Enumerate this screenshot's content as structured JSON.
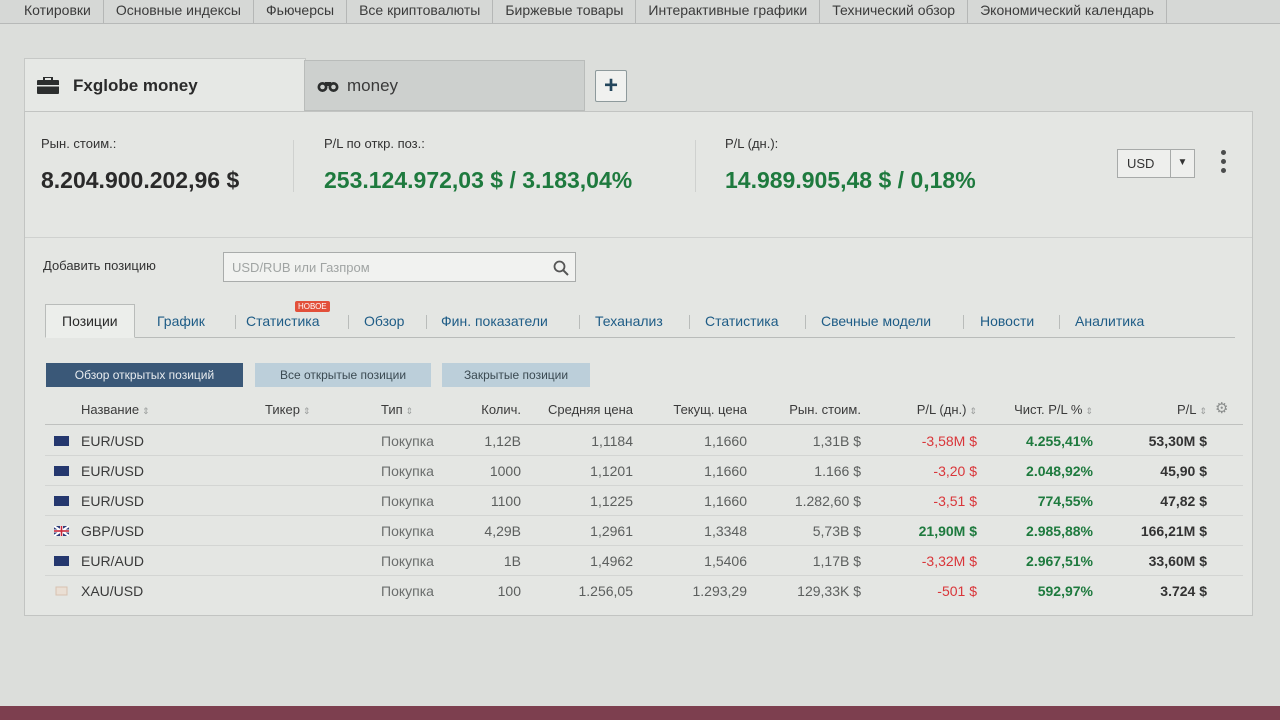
{
  "topnav": [
    "Котировки",
    "Основные индексы",
    "Фьючерсы",
    "Все криптовалюты",
    "Биржевые товары",
    "Интерактивные графики",
    "Технический обзор",
    "Экономический календарь"
  ],
  "portfolio_tabs": {
    "active": "Fxglobe money",
    "inactive": "money",
    "add_label": "+"
  },
  "summary": {
    "market_value": {
      "caption": "Рын. стоим.:",
      "value": "8.204.900.202,96 $"
    },
    "open_pl": {
      "caption": "P/L по откр. поз.:",
      "value": "253.124.972,03 $ / 3.183,04%"
    },
    "daily_pl": {
      "caption": "P/L (дн.):",
      "value": "14.989.905,48 $ / 0,18%"
    },
    "currency": "USD"
  },
  "add_position": {
    "label": "Добавить позицию",
    "placeholder": "USD/RUB или Газпром"
  },
  "subtabs": [
    "Позиции",
    "График",
    "Статистика",
    "Обзор",
    "Фин. показатели",
    "Теханализ",
    "Статистика",
    "Свечные модели",
    "Новости",
    "Аналитика"
  ],
  "new_badge": "НОВОЕ",
  "filters": [
    "Обзор открытых позиций",
    "Все открытые позиции",
    "Закрытые позиции"
  ],
  "columns": [
    "Название",
    "Тикер",
    "Тип",
    "Колич.",
    "Средняя цена",
    "Текущ. цена",
    "Рын. стоим.",
    "P/L (дн.)",
    "Чист. P/L %",
    "P/L"
  ],
  "rows": [
    {
      "name": "EUR/USD",
      "ticker": "",
      "type": "Покупка",
      "qty": "1,12B",
      "avg": "1,1184",
      "cur": "1,1660",
      "mv": "1,31B $",
      "pl_day": "-3,58M $",
      "net_pct": "4.255,41%",
      "pl": "53,30M $",
      "flag": "eu"
    },
    {
      "name": "EUR/USD",
      "ticker": "",
      "type": "Покупка",
      "qty": "1000",
      "avg": "1,1201",
      "cur": "1,1660",
      "mv": "1.166 $",
      "pl_day": "-3,20 $",
      "net_pct": "2.048,92%",
      "pl": "45,90 $",
      "flag": "eu"
    },
    {
      "name": "EUR/USD",
      "ticker": "",
      "type": "Покупка",
      "qty": "1100",
      "avg": "1,1225",
      "cur": "1,1660",
      "mv": "1.282,60 $",
      "pl_day": "-3,51 $",
      "net_pct": "774,55%",
      "pl": "47,82 $",
      "flag": "eu"
    },
    {
      "name": "GBP/USD",
      "ticker": "",
      "type": "Покупка",
      "qty": "4,29B",
      "avg": "1,2961",
      "cur": "1,3348",
      "mv": "5,73B $",
      "pl_day": "21,90M $",
      "net_pct": "2.985,88%",
      "pl": "166,21M $",
      "flag": "uk"
    },
    {
      "name": "EUR/AUD",
      "ticker": "",
      "type": "Покупка",
      "qty": "1B",
      "avg": "1,4962",
      "cur": "1,5406",
      "mv": "1,17B $",
      "pl_day": "-3,32M $",
      "net_pct": "2.967,51%",
      "pl": "33,60M $",
      "flag": "eu"
    },
    {
      "name": "XAU/USD",
      "ticker": "",
      "type": "Покупка",
      "qty": "100",
      "avg": "1.256,05",
      "cur": "1.293,29",
      "mv": "129,33K $",
      "pl_day": "-501 $",
      "net_pct": "592,97%",
      "pl": "3.724 $",
      "flag": "gold"
    }
  ],
  "colors": {
    "positive": "#1e7a3e",
    "negative": "#d9363a",
    "link": "#1e5c86",
    "active_filter": "#3a5878"
  }
}
